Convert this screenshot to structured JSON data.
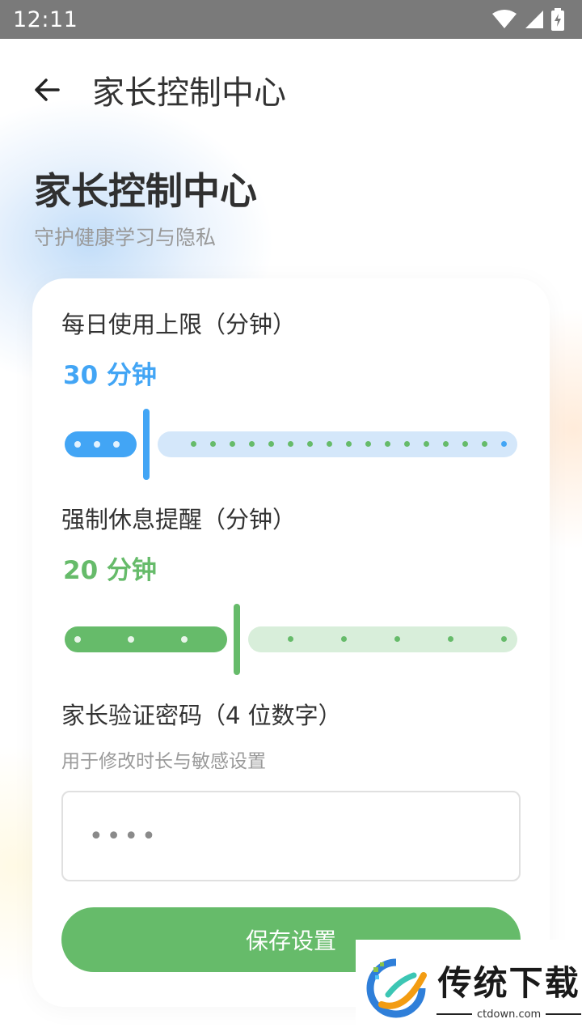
{
  "status_bar": {
    "time": "12:11"
  },
  "app_bar": {
    "title": "家长控制中心"
  },
  "header": {
    "title": "家长控制中心",
    "subtitle": "守护健康学习与隐私"
  },
  "daily_limit": {
    "label": "每日使用上限（分钟）",
    "value_text": "30 分钟",
    "value": 30,
    "fraction": 0.18,
    "color": "#42a5f5",
    "track_color": "#d4e7fa"
  },
  "break_reminder": {
    "label": "强制休息提醒（分钟）",
    "value_text": "20 分钟",
    "value": 20,
    "fraction": 0.38,
    "color": "#66bb6a",
    "track_color": "#d8eeda"
  },
  "password": {
    "label": "家长验证密码（4 位数字）",
    "hint": "用于修改时长与敏感设置",
    "placeholder": "••••"
  },
  "save_button": {
    "label": "保存设置",
    "color": "#66bb6a"
  },
  "watermark": {
    "text": "传统下载",
    "url": "ctdown.com"
  }
}
